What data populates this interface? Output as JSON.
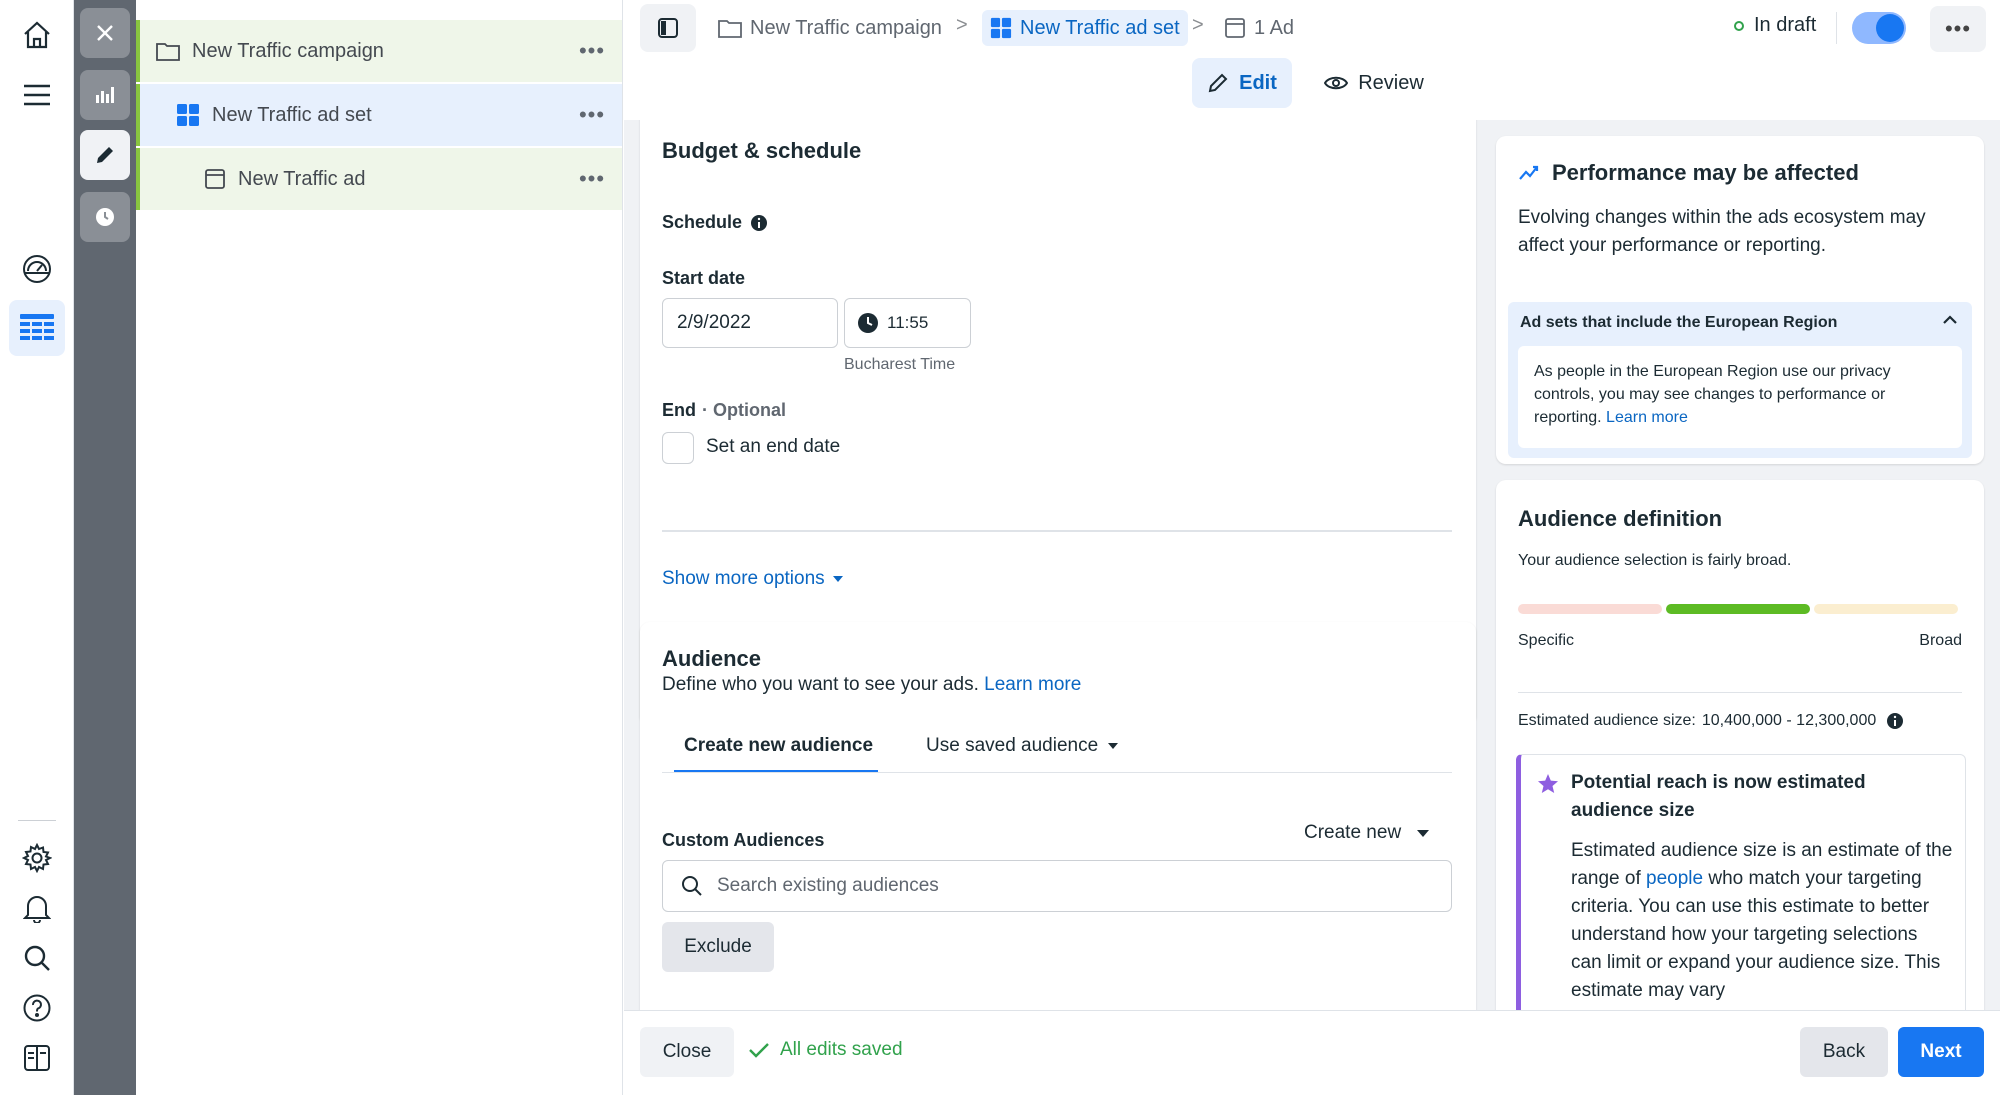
{
  "colors": {
    "accent": "#1877f2",
    "link": "#0a66c2",
    "success": "#31a24c",
    "draft_dot": "#31a24c",
    "reach_accent": "#8e5ee0"
  },
  "left_nav": {
    "icons": [
      "home-icon",
      "menu-icon",
      "dashboard-icon",
      "ads-manager-table-icon",
      "settings-icon",
      "notifications-icon",
      "search-icon",
      "help-icon",
      "reports-icon"
    ]
  },
  "tool_rail": {
    "icons": [
      "close-icon",
      "chart-icon",
      "edit-pencil-icon",
      "history-clock-icon"
    ]
  },
  "tree": {
    "campaign": "New Traffic campaign",
    "adset": "New Traffic ad set",
    "ad": "New Traffic ad",
    "more": "•••"
  },
  "topbar": {
    "crumbs": {
      "campaign": "New Traffic campaign",
      "adset": "New Traffic ad set",
      "ad": "1 Ad"
    },
    "separator": ">",
    "status": "In draft",
    "toggle_on": true,
    "more": "•••",
    "tabs": {
      "edit": "Edit",
      "review": "Review"
    }
  },
  "budget": {
    "title": "Budget & schedule",
    "schedule_label": "Schedule",
    "start_date_label": "Start date",
    "start_date": "2/9/2022",
    "start_time": "11:55",
    "timezone": "Bucharest Time",
    "end_label": "End",
    "end_optional": "· Optional",
    "end_checkbox": "Set an end date",
    "end_checked": false,
    "show_more": "Show more options"
  },
  "audience": {
    "title": "Audience",
    "subtitle": "Define who you want to see your ads.",
    "learn_more": "Learn more",
    "tab_new": "Create new audience",
    "tab_saved": "Use saved audience",
    "custom_label": "Custom Audiences",
    "create_new": "Create new",
    "search_placeholder": "Search existing audiences",
    "exclude": "Exclude"
  },
  "performance": {
    "title": "Performance may be affected",
    "body": "Evolving changes within the ads ecosystem may affect your performance or reporting.",
    "notice_title": "Ad sets that include the European Region",
    "notice_body": "As people in the European Region use our privacy controls, you may see changes to performance or reporting.",
    "notice_link": "Learn more"
  },
  "audience_definition": {
    "title": "Audience definition",
    "status": "Your audience selection is fairly broad.",
    "level": "fairly broad",
    "meter": {
      "specific": "Specific",
      "broad": "Broad"
    },
    "size_label": "Estimated audience size:",
    "size_value": "10,400,000 - 12,300,000",
    "reach_title": "Potential reach is now estimated audience size",
    "reach_body_pre": "Estimated audience size is an estimate of the range of",
    "reach_body_link": "people",
    "reach_body_post": "who match your targeting criteria. You can use this estimate to better understand how your targeting selections can limit or expand your audience size. This estimate may vary"
  },
  "footer": {
    "close": "Close",
    "saved": "All edits saved",
    "back": "Back",
    "next": "Next"
  }
}
